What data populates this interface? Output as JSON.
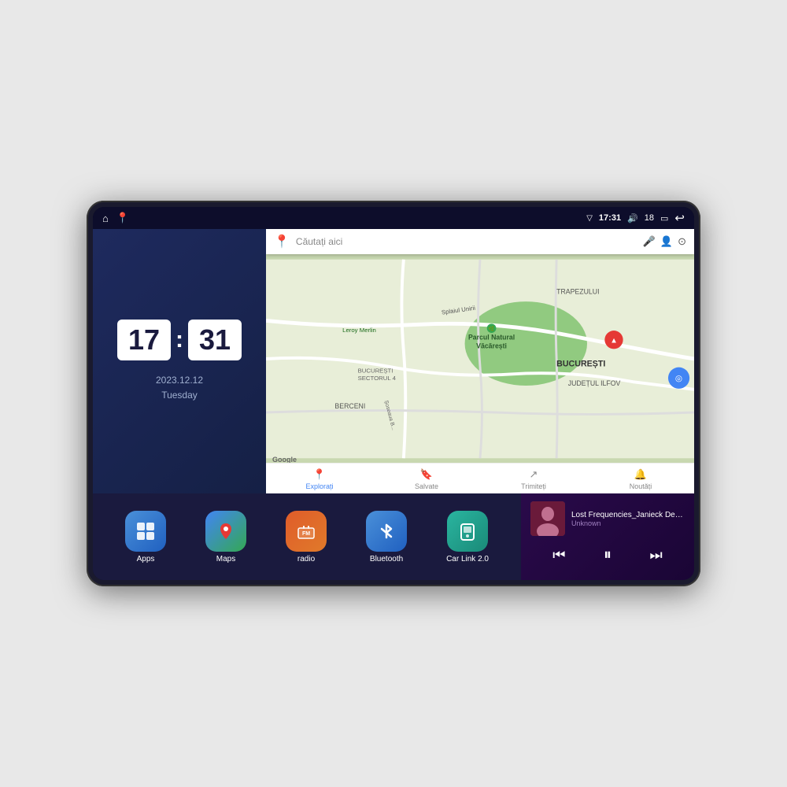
{
  "device": {
    "status_bar": {
      "signal_icon": "▽",
      "time": "17:31",
      "volume_icon": "🔊",
      "battery_level": "18",
      "battery_icon": "▭",
      "back_icon": "↩",
      "home_icon": "⌂",
      "maps_icon": "📍"
    },
    "clock": {
      "hour": "17",
      "minute": "31",
      "date": "2023.12.12",
      "day": "Tuesday"
    },
    "map": {
      "search_placeholder": "Căutați aici",
      "nav_items": [
        {
          "label": "Explorați",
          "icon": "📍",
          "active": true
        },
        {
          "label": "Salvate",
          "icon": "🔖",
          "active": false
        },
        {
          "label": "Trimiteți",
          "icon": "↗",
          "active": false
        },
        {
          "label": "Noutăți",
          "icon": "🔔",
          "active": false
        }
      ],
      "places": [
        "Parcul Natural Văcărești",
        "Leroy Merlin",
        "BUCUREȘTI",
        "JUDEȚUL ILFOV",
        "BERCENI",
        "TRAPEZULUI",
        "BUCUREȘTI SECTORUL 4"
      ]
    },
    "apps": [
      {
        "id": "apps",
        "label": "Apps",
        "icon": "⊞",
        "bg_class": "apps-icon"
      },
      {
        "id": "maps",
        "label": "Maps",
        "icon": "🗺",
        "bg_class": "maps-icon"
      },
      {
        "id": "radio",
        "label": "radio",
        "icon": "📻",
        "bg_class": "radio-icon"
      },
      {
        "id": "bluetooth",
        "label": "Bluetooth",
        "icon": "𝔅",
        "bg_class": "bluetooth-icon"
      },
      {
        "id": "carlink",
        "label": "Car Link 2.0",
        "icon": "📱",
        "bg_class": "carlink-icon"
      }
    ],
    "music": {
      "title": "Lost Frequencies_Janieck Devy-...",
      "artist": "Unknown",
      "prev_icon": "⏮",
      "play_icon": "⏸",
      "next_icon": "⏭"
    }
  }
}
